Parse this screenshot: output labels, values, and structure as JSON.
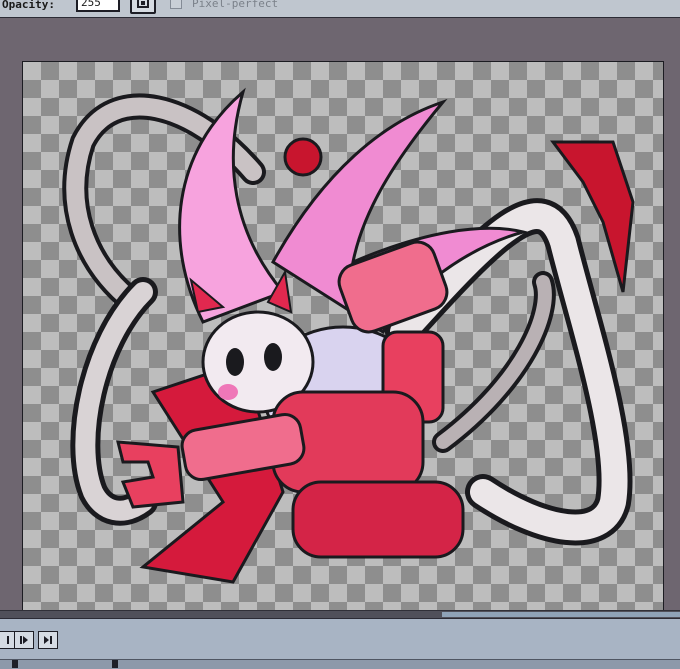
{
  "toolbar": {
    "opacity_label": "Opacity:",
    "opacity_value": "255",
    "opacity_button_icon": "eyedropper-icon",
    "pixel_perfect_label": "Pixel-perfect",
    "pixel_perfect_checked": false
  },
  "canvas": {
    "background": "transparent-checkerboard",
    "artwork": "pink and red demon girl character with mechanical tentacle arms"
  },
  "timeline": {
    "buttons": [
      {
        "icon": "first-frame-icon"
      },
      {
        "icon": "play-icon"
      },
      {
        "icon": "next-frame-icon"
      }
    ]
  },
  "colors": {
    "workspace": "#6e6670",
    "toolbar": "#bfc6cf",
    "accent_pink": "#f1608c",
    "accent_red": "#d8203e",
    "hair_pink": "#f59ad8"
  }
}
